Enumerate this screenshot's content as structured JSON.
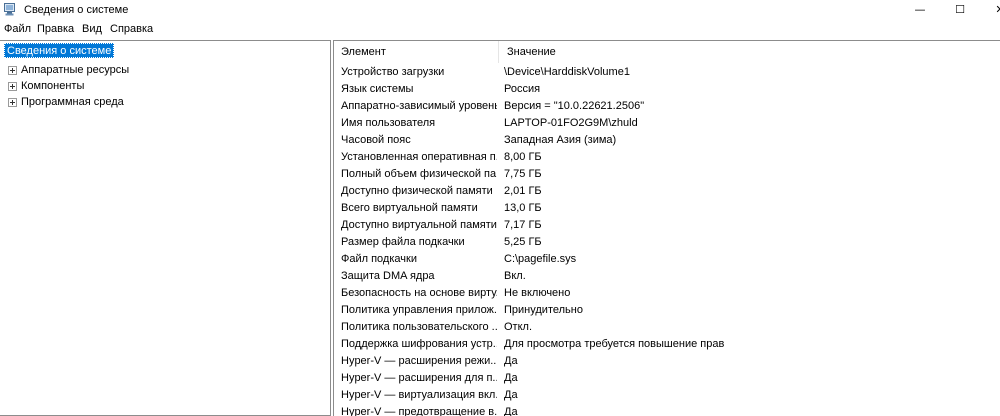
{
  "window": {
    "title": "Сведения о системе"
  },
  "controls": {
    "minimize": "—",
    "maximize": "☐",
    "close": "✕"
  },
  "menu": [
    "Файл",
    "Правка",
    "Вид",
    "Справка"
  ],
  "tree": {
    "root": "Сведения о системе",
    "children": [
      "Аппаратные ресурсы",
      "Компоненты",
      "Программная среда"
    ]
  },
  "list": {
    "headers": {
      "item": "Элемент",
      "value": "Значение"
    },
    "rows": [
      {
        "item": "Устройство загрузки",
        "value": "\\Device\\HarddiskVolume1"
      },
      {
        "item": "Язык системы",
        "value": "Россия"
      },
      {
        "item": "Аппаратно-зависимый уровень...",
        "value": "Версия = \"10.0.22621.2506\""
      },
      {
        "item": "Имя пользователя",
        "value": "LAPTOP-01FO2G9M\\zhuld"
      },
      {
        "item": "Часовой пояс",
        "value": "Западная Азия (зима)"
      },
      {
        "item": "Установленная оперативная п...",
        "value": "8,00 ГБ"
      },
      {
        "item": "Полный объем физической па...",
        "value": "7,75 ГБ"
      },
      {
        "item": "Доступно физической памяти",
        "value": "2,01 ГБ"
      },
      {
        "item": "Всего виртуальной памяти",
        "value": "13,0 ГБ"
      },
      {
        "item": "Доступно виртуальной памяти",
        "value": "7,17 ГБ"
      },
      {
        "item": "Размер файла подкачки",
        "value": "5,25 ГБ"
      },
      {
        "item": "Файл подкачки",
        "value": "C:\\pagefile.sys"
      },
      {
        "item": "Защита DMA ядра",
        "value": "Вкл."
      },
      {
        "item": "Безопасность на основе вирту...",
        "value": "Не включено"
      },
      {
        "item": "Политика управления прилож...",
        "value": "Принудительно"
      },
      {
        "item": "Политика пользовательского ...",
        "value": "Откл."
      },
      {
        "item": "Поддержка шифрования устр...",
        "value": "Для просмотра требуется повышение прав"
      },
      {
        "item": "Hyper-V — расширения режи...",
        "value": "Да"
      },
      {
        "item": "Hyper-V — расширения для п...",
        "value": "Да"
      },
      {
        "item": "Hyper-V — виртуализация вкл...",
        "value": "Да"
      },
      {
        "item": "Hyper-V — предотвращение в...",
        "value": "Да"
      }
    ]
  }
}
